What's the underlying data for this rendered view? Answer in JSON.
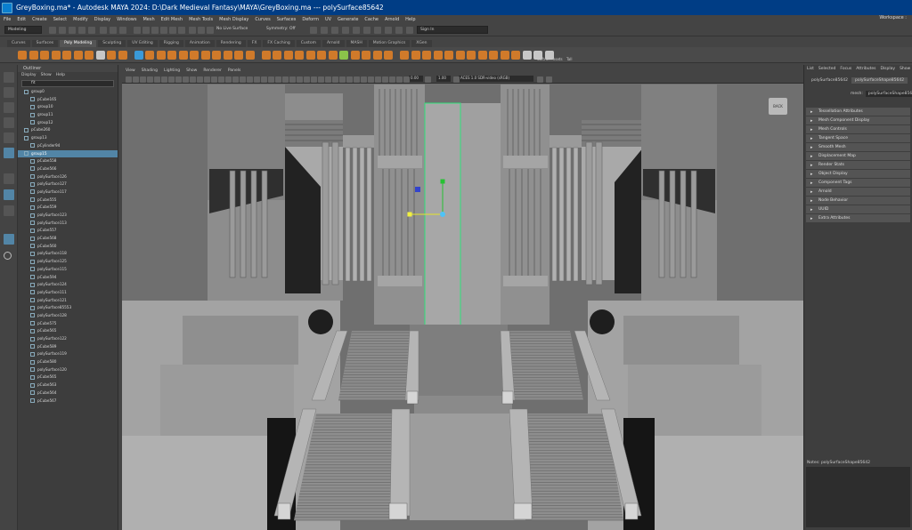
{
  "window": {
    "title": "GreyBoxing.ma* - Autodesk MAYA 2024: D:\\Dark Medieval Fantasy\\MAYA\\GreyBoxing.ma   ---   polySurface85642",
    "workspace": "Workspace :"
  },
  "menus": [
    "File",
    "Edit",
    "Create",
    "Select",
    "Modify",
    "Display",
    "Windows",
    "Mesh",
    "Edit Mesh",
    "Mesh Tools",
    "Mesh Display",
    "Curves",
    "Surfaces",
    "Deform",
    "UV",
    "Generate",
    "Cache",
    "Arnold",
    "Help"
  ],
  "statusline": {
    "mode": "Modeling",
    "live_surface": "No Live Surface",
    "symmetry": "Symmetry: Off",
    "sign_in": "Sign In"
  },
  "shelf_tabs": [
    "Curves",
    "Surfaces",
    "Poly Modeling",
    "Sculpting",
    "UV Editing",
    "Rigging",
    "Animation",
    "Rendering",
    "FX",
    "FX Caching",
    "Custom",
    "Arnold",
    "MASH",
    "Motion Graphics",
    "XGen"
  ],
  "shelf_active": "Poly Modeling",
  "shelf_labels": {
    "soft": "Soft",
    "all": "All",
    "presets": "Presets",
    "tall": "Tall"
  },
  "outliner": {
    "title": "Outliner",
    "menu": [
      "Display",
      "Show",
      "Help"
    ],
    "search": "fit",
    "rows": [
      {
        "name": "group0",
        "indent": 1,
        "sel": false
      },
      {
        "name": "pCube165",
        "indent": 2,
        "sel": false
      },
      {
        "name": "group10",
        "indent": 2,
        "sel": false
      },
      {
        "name": "group11",
        "indent": 2,
        "sel": false
      },
      {
        "name": "group12",
        "indent": 2,
        "sel": false
      },
      {
        "name": "pCube260",
        "indent": 1,
        "sel": false
      },
      {
        "name": "group13",
        "indent": 1,
        "sel": false
      },
      {
        "name": "pCylinder94",
        "indent": 2,
        "sel": false
      },
      {
        "name": "group15",
        "indent": 1,
        "sel": true
      },
      {
        "name": "pCube558",
        "indent": 2,
        "sel": false
      },
      {
        "name": "pCube566",
        "indent": 2,
        "sel": false
      },
      {
        "name": "polySurface126",
        "indent": 2,
        "sel": false
      },
      {
        "name": "polySurface127",
        "indent": 2,
        "sel": false
      },
      {
        "name": "polySurface117",
        "indent": 2,
        "sel": false
      },
      {
        "name": "pCube555",
        "indent": 2,
        "sel": false
      },
      {
        "name": "pCube559",
        "indent": 2,
        "sel": false
      },
      {
        "name": "polySurface123",
        "indent": 2,
        "sel": false
      },
      {
        "name": "polySurface113",
        "indent": 2,
        "sel": false
      },
      {
        "name": "pCube557",
        "indent": 2,
        "sel": false
      },
      {
        "name": "pCube568",
        "indent": 2,
        "sel": false
      },
      {
        "name": "pCube560",
        "indent": 2,
        "sel": false
      },
      {
        "name": "polySurface118",
        "indent": 2,
        "sel": false
      },
      {
        "name": "polySurface125",
        "indent": 2,
        "sel": false
      },
      {
        "name": "polySurface115",
        "indent": 2,
        "sel": false
      },
      {
        "name": "pCube594",
        "indent": 2,
        "sel": false
      },
      {
        "name": "polySurface124",
        "indent": 2,
        "sel": false
      },
      {
        "name": "polySurface111",
        "indent": 2,
        "sel": false
      },
      {
        "name": "polySurface121",
        "indent": 2,
        "sel": false
      },
      {
        "name": "polySurface85553",
        "indent": 2,
        "sel": false
      },
      {
        "name": "polySurface128",
        "indent": 2,
        "sel": false
      },
      {
        "name": "pCube575",
        "indent": 2,
        "sel": false
      },
      {
        "name": "pCube565",
        "indent": 2,
        "sel": false
      },
      {
        "name": "polySurface122",
        "indent": 2,
        "sel": false
      },
      {
        "name": "pCube589",
        "indent": 2,
        "sel": false
      },
      {
        "name": "polySurface119",
        "indent": 2,
        "sel": false
      },
      {
        "name": "pCube580",
        "indent": 2,
        "sel": false
      },
      {
        "name": "polySurface120",
        "indent": 2,
        "sel": false
      },
      {
        "name": "pCube565",
        "indent": 2,
        "sel": false
      },
      {
        "name": "pCube563",
        "indent": 2,
        "sel": false
      },
      {
        "name": "pCube564",
        "indent": 2,
        "sel": false
      },
      {
        "name": "pCube567",
        "indent": 2,
        "sel": false
      }
    ]
  },
  "viewport": {
    "menu": [
      "View",
      "Shading",
      "Lighting",
      "Show",
      "Renderer",
      "Panels"
    ],
    "field1": "0.00",
    "field2": "1.00",
    "colorspace": "ACES 1.0 SDR-video (sRGB)",
    "back_label": "BACK"
  },
  "attr": {
    "tabs": [
      "List",
      "Selected",
      "Focus",
      "Attributes",
      "Display",
      "Show"
    ],
    "node_tab": "polySurface85642",
    "shape_tab": "polySurfaceShape85642",
    "mesh_label": "mesh:",
    "mesh_value": "polySurfaceShape85642",
    "sections": [
      "Tessellation Attributes",
      "Mesh Component Display",
      "Mesh Controls",
      "Tangent Space",
      "Smooth Mesh",
      "Displacement Map",
      "Render Stats",
      "Object Display",
      "Component Tags",
      "Arnold",
      "Node Behavior",
      "UUID",
      "Extra Attributes"
    ],
    "notes": "Notes:  polySurfaceShape85642"
  }
}
